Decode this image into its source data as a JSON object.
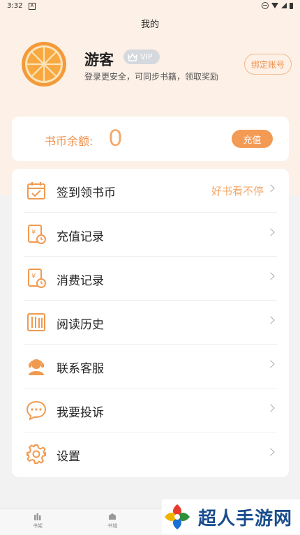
{
  "status_bar": {
    "time": "3:32",
    "notif": "A"
  },
  "header": {
    "title": "我的"
  },
  "profile": {
    "username": "游客",
    "vip_label": "VIP",
    "subtitle": "登录更安全，可同步书籍，领取奖励",
    "bind_label": "绑定账号"
  },
  "balance": {
    "label": "书币余额:",
    "value": "0",
    "recharge_label": "充值"
  },
  "menu": {
    "items": [
      {
        "label": "签到领书币",
        "hint": "好书看不停",
        "icon": "calendar-check-icon"
      },
      {
        "label": "充值记录",
        "icon": "recharge-record-icon"
      },
      {
        "label": "消费记录",
        "icon": "consume-record-icon"
      },
      {
        "label": "阅读历史",
        "icon": "reading-history-icon"
      },
      {
        "label": "联系客服",
        "icon": "customer-service-icon"
      },
      {
        "label": "我要投诉",
        "icon": "chat-bubble-icon"
      },
      {
        "label": "设置",
        "icon": "gear-icon"
      }
    ]
  },
  "bottom_nav": {
    "items": [
      {
        "label": "书架",
        "icon": "bookshelf-icon"
      },
      {
        "label": "书城",
        "icon": "bookstore-icon"
      }
    ]
  },
  "watermark": {
    "text": "超人手游网"
  },
  "colors": {
    "accent": "#f39a55",
    "header_bg": "#fdf0e6",
    "page_bg": "#f2f2f2"
  }
}
